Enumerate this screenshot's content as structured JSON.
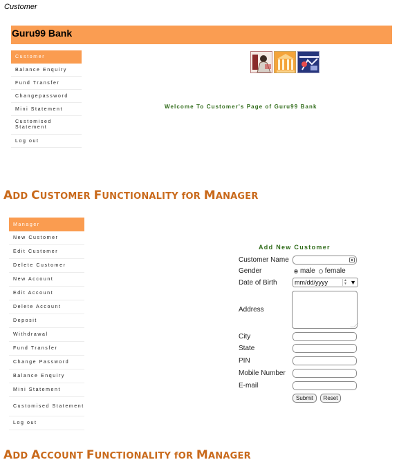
{
  "caption": "Customer",
  "bank": {
    "title": "Guru99 Bank"
  },
  "customer_menu": {
    "items": [
      {
        "label": "Customer",
        "active": true
      },
      {
        "label": "Balance Enquiry"
      },
      {
        "label": "Fund Transfer"
      },
      {
        "label": "Changepassword"
      },
      {
        "label": "Mini Statement"
      },
      {
        "label": "Customised Statement"
      },
      {
        "label": "Log out"
      }
    ]
  },
  "customer_page": {
    "image_icons": [
      "person-icon",
      "building-icon",
      "banking-icon"
    ],
    "welcome": "Welcome To Customer's Page of Guru99 Bank"
  },
  "headings": {
    "add_customer": "Add Customer Functionality for Manager",
    "add_account": "Add Account Functionality for Manager"
  },
  "manager_menu": {
    "items": [
      {
        "label": "Manager",
        "active": true
      },
      {
        "label": "New Customer"
      },
      {
        "label": "Edit Customer"
      },
      {
        "label": "Delete Customer"
      },
      {
        "label": "New Account"
      },
      {
        "label": "Edit Account"
      },
      {
        "label": "Delete Account"
      },
      {
        "label": "Deposit"
      },
      {
        "label": "Withdrawal"
      },
      {
        "label": "Fund Transfer"
      },
      {
        "label": "Change Password"
      },
      {
        "label": "Balance Enquiry"
      },
      {
        "label": "Mini Statement"
      },
      {
        "label": "Customised Statement"
      },
      {
        "label": "Log out"
      }
    ]
  },
  "form": {
    "title": "Add New Customer",
    "labels": {
      "customer_name": "Customer Name",
      "gender": "Gender",
      "dob": "Date of Birth",
      "address": "Address",
      "city": "City",
      "state": "State",
      "pin": "PIN",
      "mobile": "Mobile Number",
      "email": "E-mail"
    },
    "gender_options": {
      "male": "male",
      "female": "female",
      "selected": "male"
    },
    "dob_placeholder": "mm/dd/yyyy",
    "submit_label": "Submit",
    "reset_label": "Reset"
  }
}
